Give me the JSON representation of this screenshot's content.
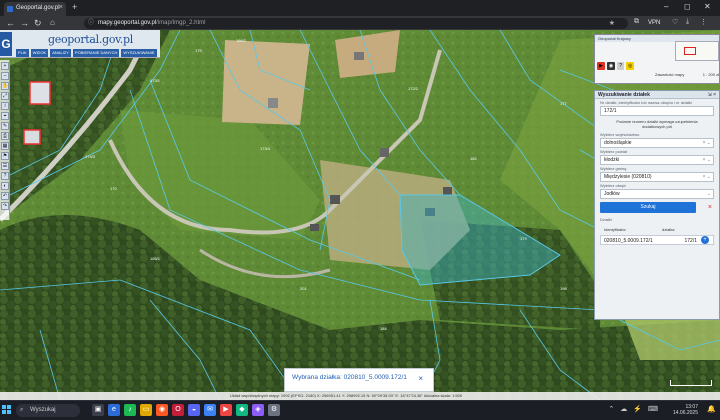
{
  "browser": {
    "tab_title": "Geoportal.gov.pl",
    "tab_close": "×",
    "new_tab": "+",
    "window_controls": [
      "–",
      "◻",
      "✕"
    ],
    "url_domain": "mapy.geoportal.gov.pl",
    "url_path": "/imap/Imgp_2.html",
    "url_prefix": "",
    "vpn_label": "VPN",
    "back": "←",
    "forward": "→",
    "reload": "↻"
  },
  "geoportal": {
    "logo_text": "geoportal.gov.pl",
    "menu": [
      "PLIK",
      "WIDOK",
      "ANALIZY",
      "POBIERANIE DANYCH",
      "WYSZUKIWANIE"
    ],
    "left_tools": [
      "+",
      "–",
      "✋",
      "⤢",
      "i",
      "⌖",
      "✎",
      "⎙",
      "▦",
      "⚑",
      "☰",
      "?",
      "◐",
      "↶",
      "↷"
    ]
  },
  "minimap": {
    "title": "Geoportal Krajowy",
    "widget_label": "Zawartość mapy",
    "widget_zoom": "1 : 200 zł"
  },
  "search_panel": {
    "title": "Wyszukiwanie działek",
    "hint": "Nr działki, identyfikator lub nazwa obrębu i nr działki",
    "query_value": "172/1",
    "note": "Podanie numeru działki wymaga uzupełnienia dodatkowych pól",
    "label_voivodeship": "Wybierz województwo",
    "voivodeship_value": "dolnośląskie",
    "label_county": "Wybierz powiat",
    "county_value": "kłodzki",
    "label_commune": "Wybierz gminę",
    "commune_value": "Międzylesie (020810)",
    "label_precinct": "Wybierz obręb",
    "precinct_value": "Jodłów",
    "search_button": "Szukaj",
    "clear_icon": "×",
    "results_label": "Działki",
    "col_identifier": "Identyfikator",
    "col_parcel": "działka",
    "result_identifier": "020810_5.0009.172/1",
    "result_parcel": "172/1",
    "add_icon": "+"
  },
  "map": {
    "parcel_labels": [
      "173/1",
      "175",
      "174/3",
      "166/2",
      "170",
      "173/4",
      "172/2",
      "182",
      "177",
      "171/2",
      "179",
      "165/1",
      "201",
      "192",
      "184",
      "176/2",
      "198"
    ],
    "selected_color": "#3fb6c8",
    "boundary_color": "#58c8e8",
    "status_text": "Układ współrzędnych mapy: 1992 (EPSG: 2180)   X: 256951.41  Y: 298992.15   N: 50°09'35.93\" E: 16°47'24.36\"   Aktualna skala: 1:500"
  },
  "popup": {
    "text": "Wybrana działka: 020810_5.0009.172/1",
    "close": "×"
  },
  "taskbar": {
    "search_placeholder": "Wyszukaj",
    "time": "13:07",
    "date": "14.06.2025",
    "language": "POL"
  }
}
